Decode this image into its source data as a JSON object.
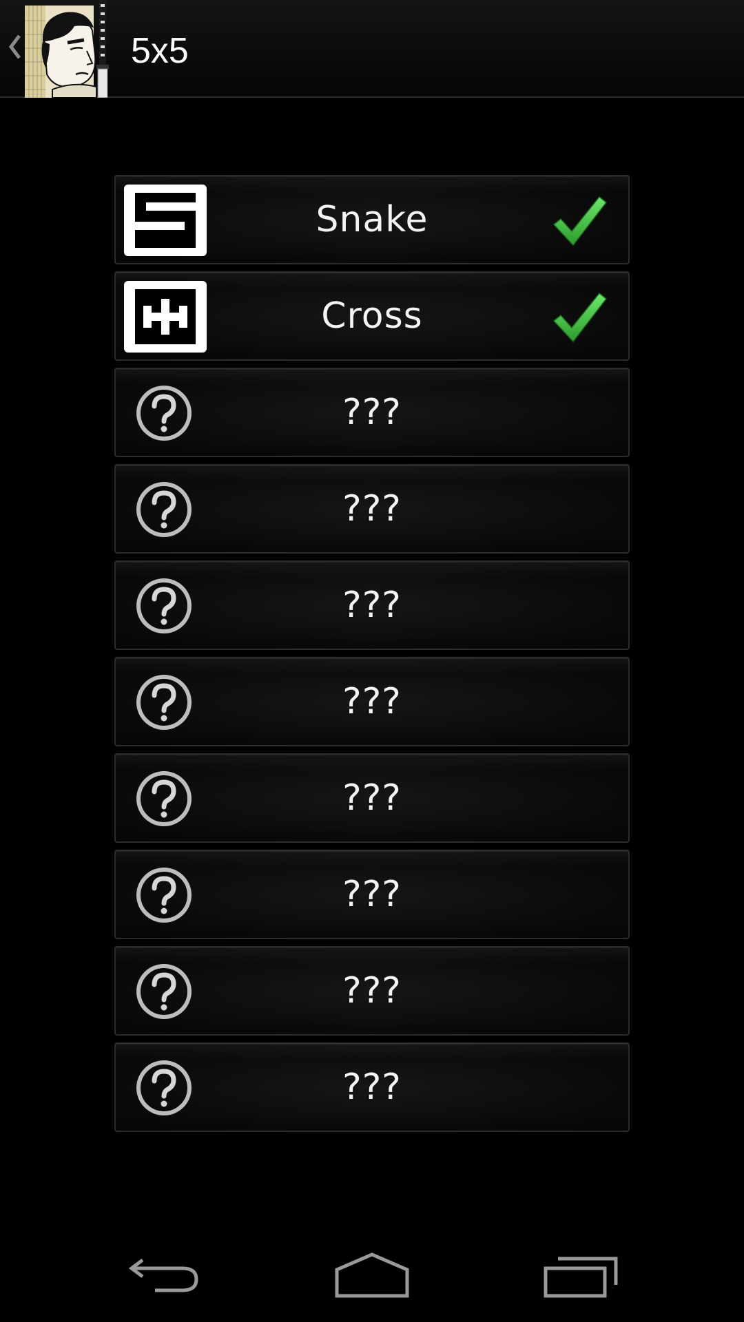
{
  "action_bar": {
    "title": "5x5",
    "up_icon": "chevron-left-icon",
    "app_icon": "samurai-app-icon"
  },
  "levels": [
    {
      "label": "Snake",
      "icon": "snake-pattern-icon",
      "solved": true
    },
    {
      "label": "Cross",
      "icon": "cross-pattern-icon",
      "solved": true
    },
    {
      "label": "???",
      "icon": "question-icon",
      "solved": false
    },
    {
      "label": "???",
      "icon": "question-icon",
      "solved": false
    },
    {
      "label": "???",
      "icon": "question-icon",
      "solved": false
    },
    {
      "label": "???",
      "icon": "question-icon",
      "solved": false
    },
    {
      "label": "???",
      "icon": "question-icon",
      "solved": false
    },
    {
      "label": "???",
      "icon": "question-icon",
      "solved": false
    },
    {
      "label": "???",
      "icon": "question-icon",
      "solved": false
    },
    {
      "label": "???",
      "icon": "question-icon",
      "solved": false
    }
  ],
  "nav_bar": {
    "back_icon": "back-icon",
    "home_icon": "home-icon",
    "recents_icon": "recent-apps-icon"
  },
  "colors": {
    "background": "#000000",
    "check": "#3fbf3f",
    "row_border": "#2c2c2c",
    "text": "#ffffff"
  }
}
